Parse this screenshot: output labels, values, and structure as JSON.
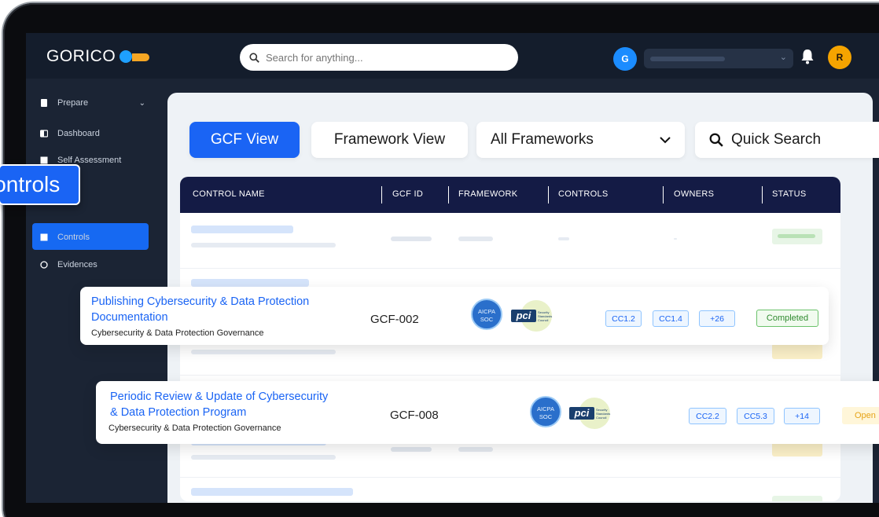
{
  "app": {
    "logo_text": "GORICO",
    "search_placeholder": "Search for anything...",
    "user_avatar_letter": "G",
    "profile_avatar_letter": "R"
  },
  "sidebar": {
    "items": [
      {
        "label": "Prepare",
        "icon": "clipboard-icon"
      },
      {
        "label": "Dashboard",
        "icon": "dashboard-icon"
      },
      {
        "label": "Self Assessment",
        "icon": "assessment-icon"
      },
      {
        "label": "Controls",
        "icon": "controls-icon"
      },
      {
        "label": "Evidences",
        "icon": "evidence-icon"
      }
    ],
    "highlight_label": "Controls"
  },
  "toolbar": {
    "gcf_view": "GCF View",
    "framework_view": "Framework View",
    "frameworks_select": "All Frameworks",
    "quick_search": "Quick Search"
  },
  "table": {
    "columns": [
      "CONTROL NAME",
      "GCF ID",
      "FRAMEWORK",
      "CONTROLS",
      "OWNERS",
      "STATUS"
    ]
  },
  "rows": [
    {
      "title_line1": "Publishing Cybersecurity & Data Protection",
      "title_line2": "Documentation",
      "subtitle": "Cybersecurity & Data Protection Governance",
      "gcf_id": "GCF-002",
      "frameworks": [
        "AICPA SOC",
        "PCI Security Standards Council"
      ],
      "controls": [
        "CC1.2",
        "CC1.4",
        "+26"
      ],
      "status": "Completed"
    },
    {
      "title_line1": "Periodic Review & Update of Cybersecurity",
      "title_line2": "& Data Protection Program",
      "subtitle": "Cybersecurity & Data Protection Governance",
      "gcf_id": "GCF-008",
      "frameworks": [
        "AICPA SOC",
        "PCI Security Standards Council"
      ],
      "controls": [
        "CC2.2",
        "CC5.3",
        "+14"
      ],
      "status": "Open"
    }
  ],
  "logos": {
    "aicpa_line1": "AICPA",
    "aicpa_line2": "SOC",
    "pci_mark": "pci",
    "pci_caption": "Security Standards Council"
  },
  "colors": {
    "accent": "#1a64f4",
    "header_navy": "#141b45",
    "completed": "#2f8a2f",
    "open": "#e6a317"
  }
}
